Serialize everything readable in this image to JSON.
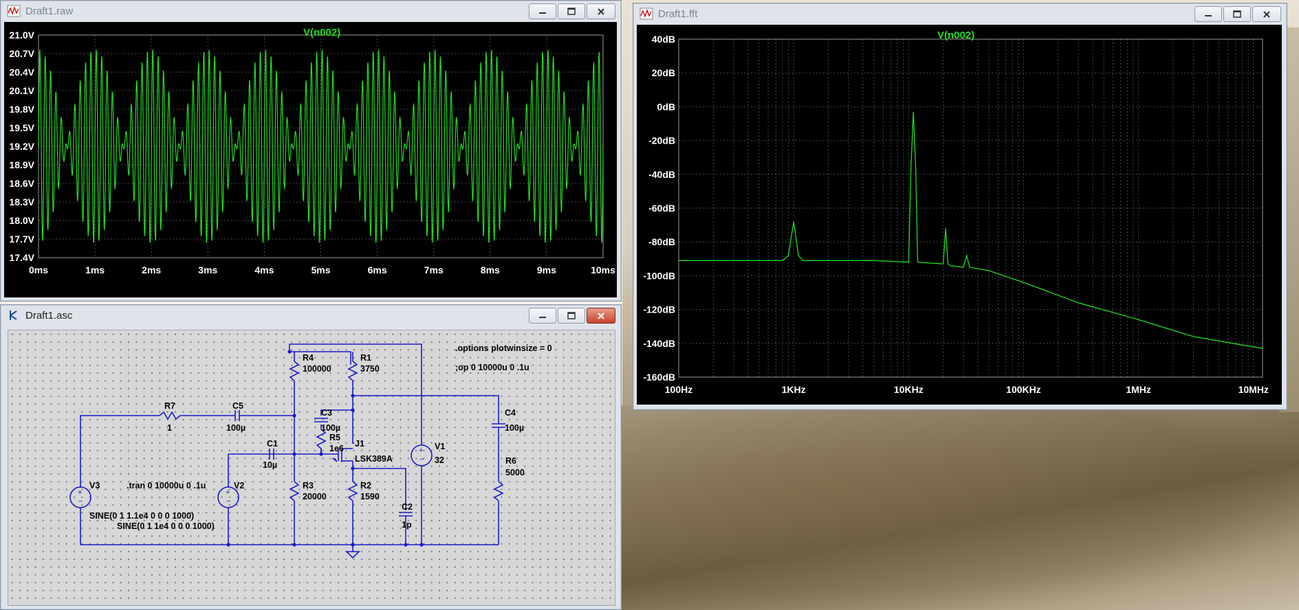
{
  "raw_window": {
    "title": "Draft1.raw",
    "trace": "V(n002)",
    "y_ticks": [
      "21.0V",
      "20.7V",
      "20.4V",
      "20.1V",
      "19.8V",
      "19.5V",
      "19.2V",
      "18.9V",
      "18.6V",
      "18.3V",
      "18.0V",
      "17.7V",
      "17.4V"
    ],
    "x_ticks": [
      "0ms",
      "1ms",
      "2ms",
      "3ms",
      "4ms",
      "5ms",
      "6ms",
      "7ms",
      "8ms",
      "9ms",
      "10ms"
    ]
  },
  "fft_window": {
    "title": "Draft1.fft",
    "trace": "V(n002)",
    "y_ticks": [
      "40dB",
      "20dB",
      "0dB",
      "-20dB",
      "-40dB",
      "-60dB",
      "-80dB",
      "-100dB",
      "-120dB",
      "-140dB",
      "-160dB"
    ],
    "x_ticks": [
      "100Hz",
      "1KHz",
      "10KHz",
      "100KHz",
      "1MHz",
      "10MHz"
    ]
  },
  "asc_window": {
    "title": "Draft1.asc",
    "directives": {
      "options": ".options plotwinsize = 0",
      "op": ";op 0 10000u 0 .1u",
      "tran": ".tran 0 10000u 0 .1u"
    },
    "components": {
      "R4": {
        "name": "R4",
        "value": "100000"
      },
      "R1": {
        "name": "R1",
        "value": "3750"
      },
      "R7": {
        "name": "R7",
        "value": "1"
      },
      "C5": {
        "name": "C5",
        "value": "100µ"
      },
      "C3": {
        "name": "C3",
        "value": "100µ"
      },
      "R5": {
        "name": "R5",
        "value": "1e6"
      },
      "V1": {
        "name": "V1",
        "value": "32"
      },
      "C4": {
        "name": "C4",
        "value": "100µ"
      },
      "C1": {
        "name": "C1",
        "value": "10µ"
      },
      "J1": {
        "name": "J1",
        "value": "LSK389A"
      },
      "V3": {
        "name": "V3",
        "value": "SINE(0 1 1.1e4 0 0 0 1000)"
      },
      "V2": {
        "name": "V2",
        "value": "SINE(0 1 1e4 0 0 0 1000)"
      },
      "R6": {
        "name": "R6",
        "value": "5000"
      },
      "R3": {
        "name": "R3",
        "value": "20000"
      },
      "R2": {
        "name": "R2",
        "value": "1590"
      },
      "C2": {
        "name": "C2",
        "value": "1p"
      }
    }
  },
  "colors": {
    "trace": "#22dd22",
    "plot_bg": "#000000",
    "wire": "#1a1acc",
    "grid": "#4a4a4a"
  },
  "chart_data": [
    {
      "type": "line",
      "title": "V(n002)",
      "xlabel": "",
      "ylabel": "",
      "xlim": [
        0,
        10
      ],
      "x_unit": "ms",
      "ylim": [
        17.4,
        21.0
      ],
      "y_unit": "V",
      "grid": true,
      "description_of_signal": "two-tone sine around 19.2V, beat envelope ~1 kHz, peak-to-peak ~3.2V",
      "carrier_hz": 10000,
      "tone2_hz": 11000,
      "center": 19.2,
      "amplitude": 0.8
    },
    {
      "type": "line",
      "title": "V(n002)",
      "xlabel": "",
      "ylabel": "",
      "x_scale": "log",
      "xlim": [
        100,
        12000000
      ],
      "x_unit": "Hz",
      "ylim": [
        -160,
        40
      ],
      "y_unit": "dB",
      "grid": true,
      "x": [
        100,
        800,
        900,
        1000,
        1100,
        1200,
        5000,
        10000,
        10500,
        11000,
        11500,
        12000,
        20000,
        21000,
        22000,
        23000,
        30000,
        32000,
        34000,
        50000,
        100000,
        300000,
        1000000,
        3000000,
        12000000
      ],
      "y": [
        -91,
        -91,
        -88,
        -68,
        -88,
        -91,
        -91,
        -92,
        -35,
        -3,
        -35,
        -92,
        -93,
        -72,
        -93,
        -94,
        -95,
        -88,
        -95,
        -97,
        -104,
        -116,
        -126,
        -136,
        -143
      ]
    }
  ]
}
